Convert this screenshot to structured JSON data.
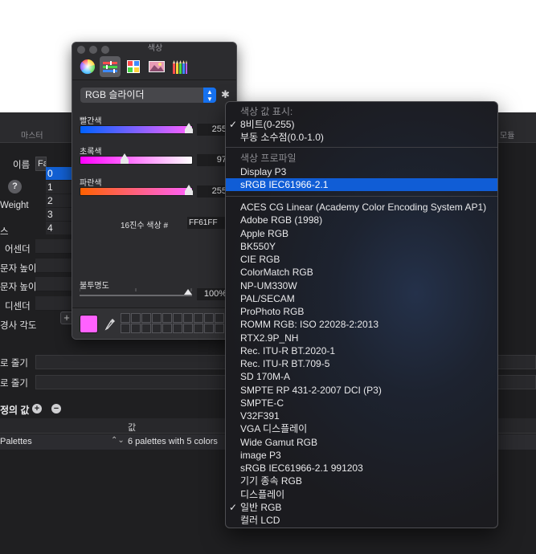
{
  "background": {
    "tabs": [
      "마스터",
      "모듈"
    ],
    "labels": {
      "name": "이름",
      "weight": "Weight",
      "section_glyph": "스",
      "descender": "어센더",
      "char_height1": "문자 높이",
      "char_height2": "문자 높이",
      "descender2": "디센더",
      "angle": "경사 각도",
      "row_stripe1": "로 줄기",
      "row_stripe2": "로 줄기"
    },
    "name_value": "Fa",
    "help_label": "?",
    "index_list": [
      "0",
      "1",
      "2",
      "3",
      "4"
    ],
    "add_label": "+",
    "definitions_label": "정의 값",
    "add_icon": "+",
    "remove_icon": "−",
    "table": {
      "col_value": "값",
      "row_key": "Palettes",
      "row_stepper": "⌃⌄",
      "row_value": "6 palettes with 5 colors"
    }
  },
  "picker": {
    "title": "색상",
    "modes": [
      "color-wheel",
      "sliders",
      "palettes",
      "image",
      "pencils"
    ],
    "active_mode": "sliders",
    "model_select": "RGB 슬라이더",
    "sliders": [
      {
        "label": "빨간색",
        "value": "255",
        "fraction": 1.0
      },
      {
        "label": "초록색",
        "value": "97",
        "fraction": 0.38
      },
      {
        "label": "파란색",
        "value": "255",
        "fraction": 1.0
      }
    ],
    "hex_label": "16진수 색상 #",
    "hex_value": "FF61FF",
    "opacity_label": "불투명도",
    "opacity_value": "100%",
    "opacity_fraction": 1.0,
    "current_color": "#ff61ff"
  },
  "menu": {
    "header1": "색상 값 표시:",
    "value_modes": [
      {
        "label": "8비트(0-255)",
        "checked": true
      },
      {
        "label": "부동 소수점(0.0-1.0)",
        "checked": false
      }
    ],
    "header2": "색상 프로파일",
    "top_profiles": [
      {
        "label": "Display P3",
        "selected": false
      },
      {
        "label": "sRGB IEC61966-2.1",
        "selected": true
      }
    ],
    "profiles": [
      {
        "label": "ACES CG Linear (Academy Color Encoding System AP1)"
      },
      {
        "label": "Adobe RGB (1998)"
      },
      {
        "label": "Apple RGB"
      },
      {
        "label": "BK550Y"
      },
      {
        "label": "CIE RGB"
      },
      {
        "label": "ColorMatch RGB"
      },
      {
        "label": "NP-UM330W"
      },
      {
        "label": "PAL/SECAM"
      },
      {
        "label": "ProPhoto RGB"
      },
      {
        "label": "ROMM RGB: ISO 22028-2:2013"
      },
      {
        "label": "RTX2.9P_NH"
      },
      {
        "label": "Rec. ITU-R BT.2020-1"
      },
      {
        "label": "Rec. ITU-R BT.709-5"
      },
      {
        "label": "SD 170M-A"
      },
      {
        "label": "SMPTE RP 431-2-2007 DCI (P3)"
      },
      {
        "label": "SMPTE-C"
      },
      {
        "label": "V32F391"
      },
      {
        "label": "VGA 디스플레이"
      },
      {
        "label": "Wide Gamut RGB"
      },
      {
        "label": "image P3"
      },
      {
        "label": "sRGB IEC61966-2.1 991203"
      },
      {
        "label": "기기 종속 RGB"
      },
      {
        "label": "디스플레이"
      },
      {
        "label": "일반 RGB",
        "checked": true
      },
      {
        "label": "컬러 LCD"
      }
    ],
    "check_glyph": "✓",
    "accent": "#105dd6"
  }
}
